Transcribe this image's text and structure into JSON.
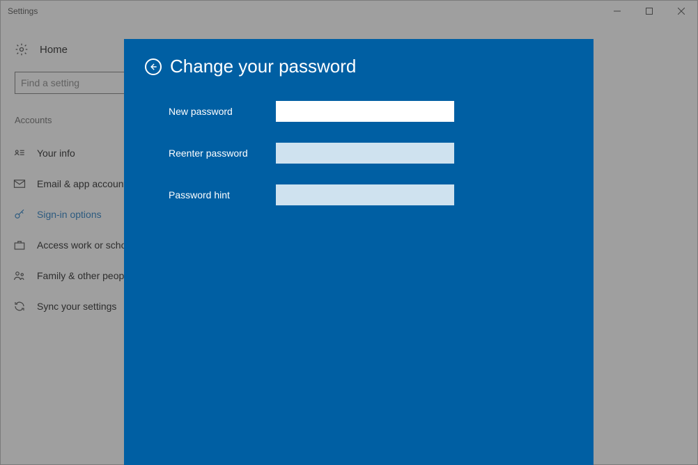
{
  "window": {
    "title": "Settings"
  },
  "sidebar": {
    "home_label": "Home",
    "search_placeholder": "Find a setting",
    "section_label": "Accounts",
    "items": [
      {
        "label": "Your info"
      },
      {
        "label": "Email & app accounts"
      },
      {
        "label": "Sign-in options"
      },
      {
        "label": "Access work or school"
      },
      {
        "label": "Family & other people"
      },
      {
        "label": "Sync your settings"
      }
    ]
  },
  "modal": {
    "title": "Change your password",
    "fields": {
      "new_password": {
        "label": "New password",
        "value": ""
      },
      "reenter_password": {
        "label": "Reenter password",
        "value": ""
      },
      "password_hint": {
        "label": "Password hint",
        "value": ""
      }
    }
  }
}
